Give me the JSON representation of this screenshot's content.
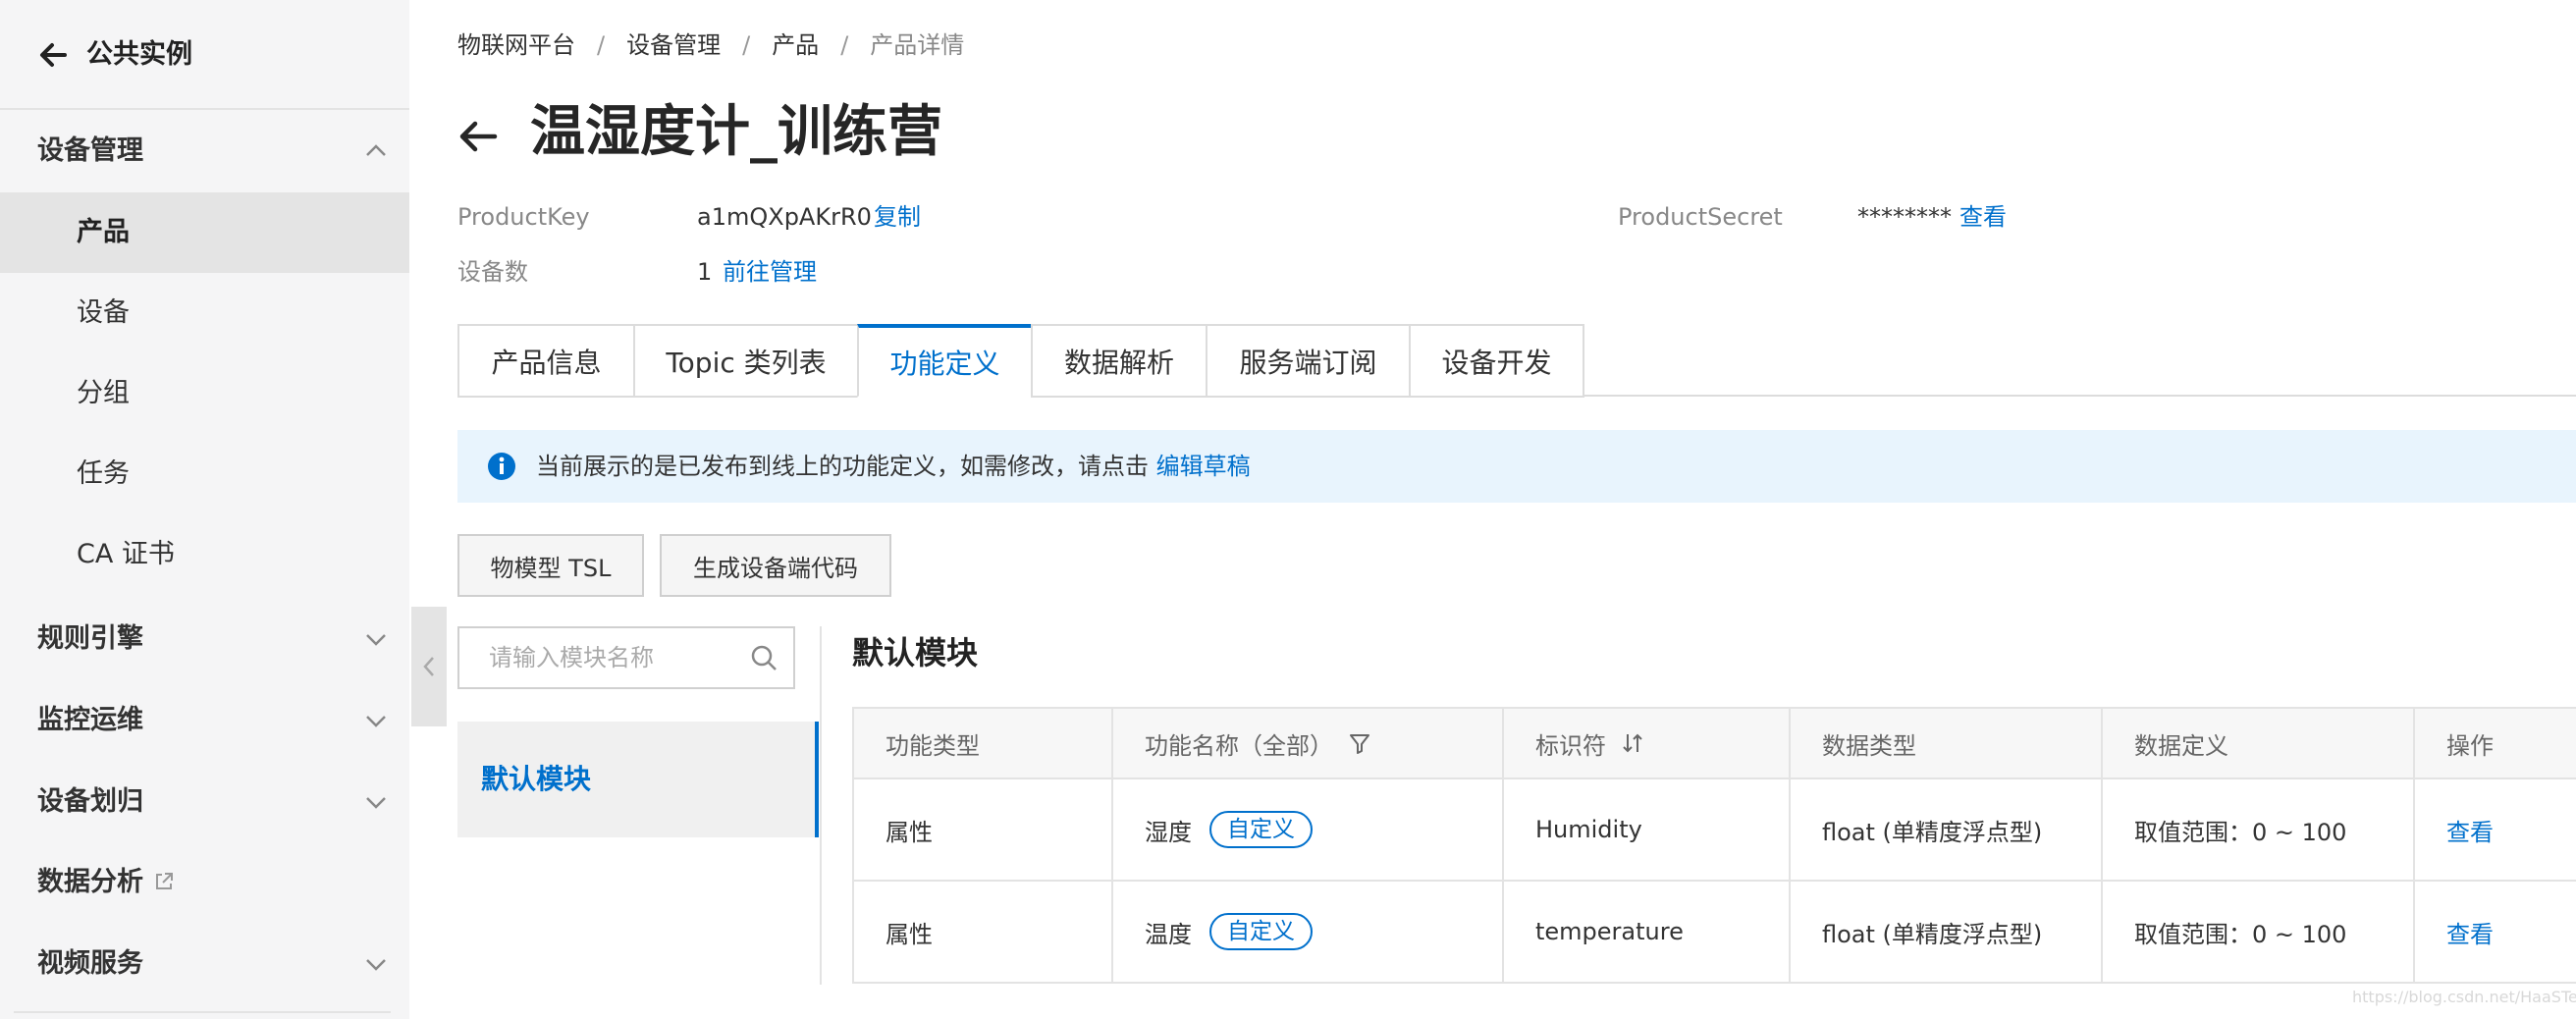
{
  "sidebar": {
    "header_title": "公共实例",
    "groups": [
      {
        "label": "设备管理"
      },
      {
        "label": "规则引擎"
      },
      {
        "label": "监控运维"
      },
      {
        "label": "设备划归"
      },
      {
        "label": "数据分析"
      },
      {
        "label": "视频服务"
      }
    ],
    "items": [
      {
        "label": "产品",
        "active": true
      },
      {
        "label": "设备"
      },
      {
        "label": "分组"
      },
      {
        "label": "任务"
      },
      {
        "label": "CA 证书"
      }
    ]
  },
  "breadcrumb": [
    "物联网平台",
    "设备管理",
    "产品",
    "产品详情"
  ],
  "breadcrumb_separator": "/",
  "page_title": "温湿度计_训练营",
  "meta": {
    "product_key_label": "ProductKey",
    "product_key_value": "a1mQXpAKrR0",
    "copy_link": "复制",
    "product_secret_label": "ProductSecret",
    "product_secret_value": "********",
    "view_link": "查看",
    "device_count_label": "设备数",
    "device_count_value": "1",
    "manage_link": "前往管理"
  },
  "tabs": [
    {
      "label": "产品信息"
    },
    {
      "label": "Topic 类列表"
    },
    {
      "label": "功能定义",
      "active": true
    },
    {
      "label": "数据解析"
    },
    {
      "label": "服务端订阅"
    },
    {
      "label": "设备开发"
    }
  ],
  "notice": {
    "text": "当前展示的是已发布到线上的功能定义，如需修改，请点击",
    "link": "编辑草稿"
  },
  "buttons": {
    "tsl": "物模型 TSL",
    "gen_code": "生成设备端代码"
  },
  "module_search": {
    "placeholder": "请输入模块名称"
  },
  "modules": [
    {
      "label": "默认模块",
      "active": true
    }
  ],
  "section_title": "默认模块",
  "table": {
    "headers": [
      "功能类型",
      "功能名称（全部）",
      "标识符",
      "数据类型",
      "数据定义",
      "操作"
    ],
    "rows": [
      {
        "type": "属性",
        "name": "湿度",
        "tag": "自定义",
        "identifier": "Humidity",
        "data_type": "float (单精度浮点型)",
        "definition": "取值范围：0 ~ 100",
        "action": "查看"
      },
      {
        "type": "属性",
        "name": "温度",
        "tag": "自定义",
        "identifier": "temperature",
        "data_type": "float (单精度浮点型)",
        "definition": "取值范围：0 ~ 100",
        "action": "查看"
      }
    ]
  },
  "watermark": "https://blog.csdn.net/HaaSTech",
  "colors": {
    "accent": "#0070cc",
    "notice_bg": "#e8f4fd",
    "sidebar_bg": "#f5f5f6"
  }
}
